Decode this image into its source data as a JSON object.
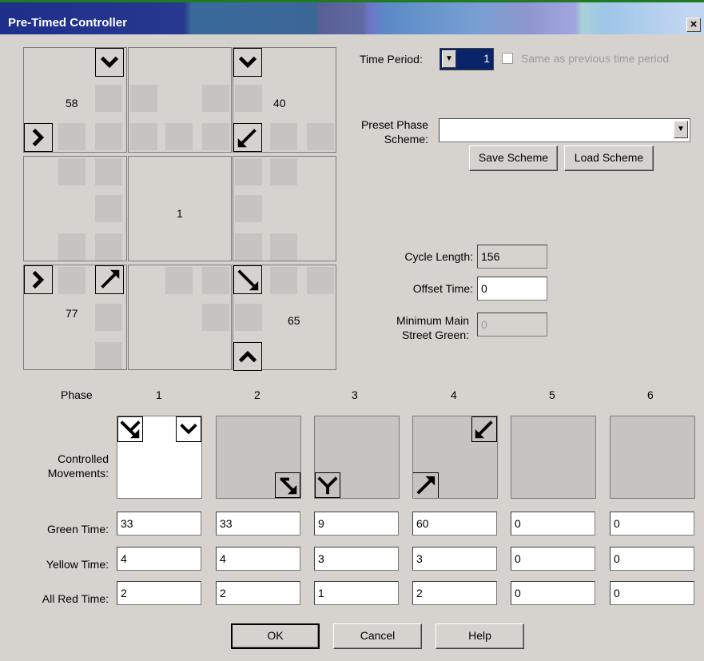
{
  "window": {
    "title": "Pre-Timed Controller",
    "close_label": "×"
  },
  "grid": {
    "nw": {
      "value": "58",
      "icons": [
        "chevron-down-icon",
        "chevron-right-icon"
      ]
    },
    "ne": {
      "value": "40",
      "icons": [
        "chevron-down-icon",
        "arrow-down-left-icon"
      ]
    },
    "center": {
      "value": "1"
    },
    "sw": {
      "value": "77",
      "icons": [
        "chevron-right-icon",
        "arrow-up-right-icon"
      ]
    },
    "se": {
      "value": "65",
      "icons": [
        "arrow-down-right-icon",
        "chevron-up-icon"
      ]
    }
  },
  "time_period": {
    "label": "Time Period:",
    "value": "1",
    "same_as_previous_label": "Same as previous time period"
  },
  "preset": {
    "label_line1": "Preset Phase",
    "label_line2": "Scheme:",
    "value": "",
    "save_label": "Save Scheme",
    "load_label": "Load Scheme"
  },
  "timing": {
    "cycle_length_label": "Cycle Length:",
    "cycle_length_value": "156",
    "offset_label": "Offset Time:",
    "offset_value": "0",
    "min_green_label_line1": "Minimum Main",
    "min_green_label_line2": "Street Green:",
    "min_green_value": "0"
  },
  "phases": {
    "header_label": "Phase",
    "controlled_label_line1": "Controlled",
    "controlled_label_line2": "Movements:",
    "green_label": "Green Time:",
    "yellow_label": "Yellow Time:",
    "allred_label": "All Red Time:",
    "columns": [
      {
        "num": "1",
        "green": "33",
        "yellow": "4",
        "allred": "2"
      },
      {
        "num": "2",
        "green": "33",
        "yellow": "4",
        "allred": "2"
      },
      {
        "num": "3",
        "green": "9",
        "yellow": "3",
        "allred": "1"
      },
      {
        "num": "4",
        "green": "60",
        "yellow": "3",
        "allred": "2"
      },
      {
        "num": "5",
        "green": "0",
        "yellow": "0",
        "allred": "0"
      },
      {
        "num": "6",
        "green": "0",
        "yellow": "0",
        "allred": "0"
      }
    ]
  },
  "buttons": {
    "ok": "OK",
    "cancel": "Cancel",
    "help": "Help"
  }
}
